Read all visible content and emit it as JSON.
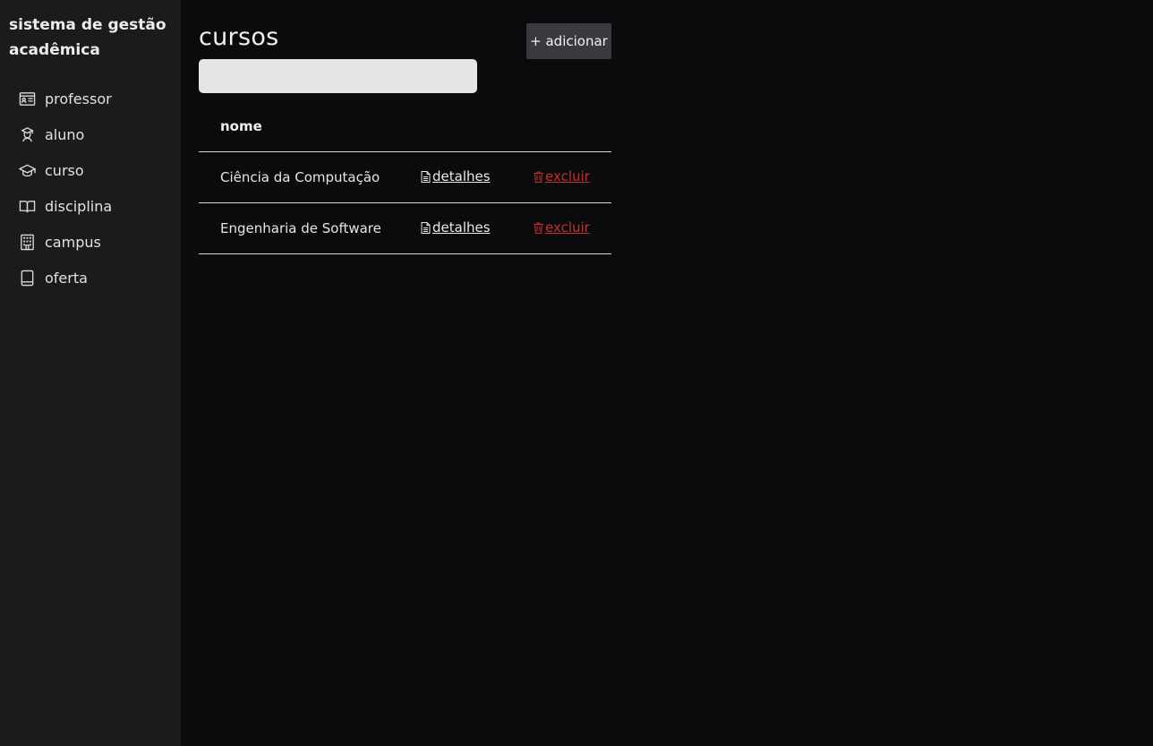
{
  "app": {
    "title": "sistema de gestão acadêmica"
  },
  "sidebar": {
    "items": [
      {
        "label": "professor",
        "icon": "id-card-icon"
      },
      {
        "label": "aluno",
        "icon": "student-icon"
      },
      {
        "label": "curso",
        "icon": "graduation-cap-icon"
      },
      {
        "label": "disciplina",
        "icon": "open-book-icon"
      },
      {
        "label": "campus",
        "icon": "building-icon"
      },
      {
        "label": "oferta",
        "icon": "book-icon"
      }
    ]
  },
  "main": {
    "title": "cursos",
    "add_button_label": "+ adicionar",
    "search": {
      "value": "",
      "placeholder": ""
    },
    "table": {
      "columns": [
        "nome"
      ],
      "rows": [
        {
          "name": "Ciência da Computação",
          "details_label": "detalhes",
          "delete_label": "excluir"
        },
        {
          "name": "Engenharia de Software",
          "details_label": "detalhes",
          "delete_label": "excluir"
        }
      ]
    }
  },
  "colors": {
    "sidebar_bg": "#1b1b1d",
    "main_bg": "#0b0b0d",
    "delete": "#c9302c",
    "button_bg": "#3a3a3e"
  }
}
